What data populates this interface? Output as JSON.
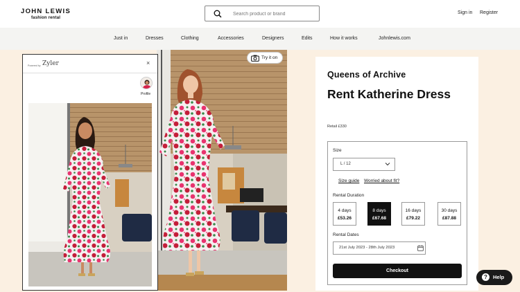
{
  "header": {
    "logo_main": "JOHN LEWIS",
    "logo_sub": "fashion rental",
    "search_placeholder": "Search product or brand",
    "sign_in": "Sign in",
    "register": "Register"
  },
  "nav": {
    "items": [
      "Just in",
      "Dresses",
      "Clothing",
      "Accessories",
      "Designers",
      "Edits",
      "How it works",
      "Johnlewis.com"
    ]
  },
  "zyler": {
    "powered_by": "Powered by",
    "name": "Zyler",
    "close": "×",
    "profile_label": "Profile",
    "try_it_on": "Try it on"
  },
  "product": {
    "brand": "Queens of Archive",
    "title": "Rent Katherine Dress",
    "retail": "Retail £330",
    "size_label": "Size",
    "size_value": "L / 12",
    "size_guide": "Size guide",
    "worried_fit": "Worried about fit?",
    "duration_label": "Rental Duration",
    "durations": [
      {
        "days": "4 days",
        "price": "£53.26",
        "selected": false
      },
      {
        "days": "8 days",
        "price": "£67.68",
        "selected": true
      },
      {
        "days": "16 days",
        "price": "£79.22",
        "selected": false
      },
      {
        "days": "30 days",
        "price": "£87.88",
        "selected": false
      }
    ],
    "dates_label": "Rental Dates",
    "dates_value": "21st July 2023 - 28th July 2023",
    "checkout": "Checkout"
  },
  "help": {
    "icon": "?",
    "label": "Help"
  },
  "colors": {
    "page_bg": "#fbf0e2",
    "nav_bg": "#f4f4f2",
    "dress_pink": "#e8336f",
    "dress_red": "#c41e3a",
    "primary_button": "#111111"
  }
}
